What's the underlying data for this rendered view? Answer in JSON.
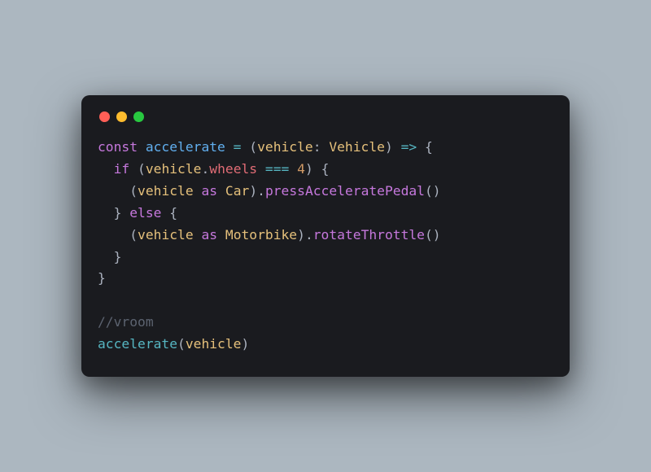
{
  "window": {
    "traffic_lights": [
      "red",
      "yellow",
      "green"
    ]
  },
  "code": {
    "l1": {
      "const": "const",
      "sp": " ",
      "fn": "accelerate",
      "eq": " = ",
      "op": "(",
      "param": "vehicle",
      "colon": ": ",
      "type": "Vehicle",
      "cp": ")",
      "arrow": " => ",
      "ob": "{"
    },
    "l2": {
      "indent": "  ",
      "if": "if",
      "sp": " ",
      "op": "(",
      "param": "vehicle",
      "dot": ".",
      "prop": "wheels",
      "eqeq": " === ",
      "num": "4",
      "cp": ")",
      "sp2": " ",
      "ob": "{"
    },
    "l3": {
      "indent": "    ",
      "op": "(",
      "param": "vehicle",
      "sp": " ",
      "as": "as",
      "sp2": " ",
      "type": "Car",
      "cp": ")",
      "dot": ".",
      "method": "pressAcceleratePedal",
      "call": "()"
    },
    "l4": {
      "indent": "  ",
      "cb": "}",
      "sp": " ",
      "else": "else",
      "sp2": " ",
      "ob": "{"
    },
    "l5": {
      "indent": "    ",
      "op": "(",
      "param": "vehicle",
      "sp": " ",
      "as": "as",
      "sp2": " ",
      "type": "Motorbike",
      "cp": ")",
      "dot": ".",
      "method": "rotateThrottle",
      "call": "()"
    },
    "l6": {
      "indent": "  ",
      "cb": "}"
    },
    "l7": {
      "cb": "}"
    },
    "l8": {
      "blank": ""
    },
    "l9": {
      "comment": "//vroom"
    },
    "l10": {
      "fn": "accelerate",
      "op": "(",
      "param": "vehicle",
      "cp": ")"
    }
  }
}
